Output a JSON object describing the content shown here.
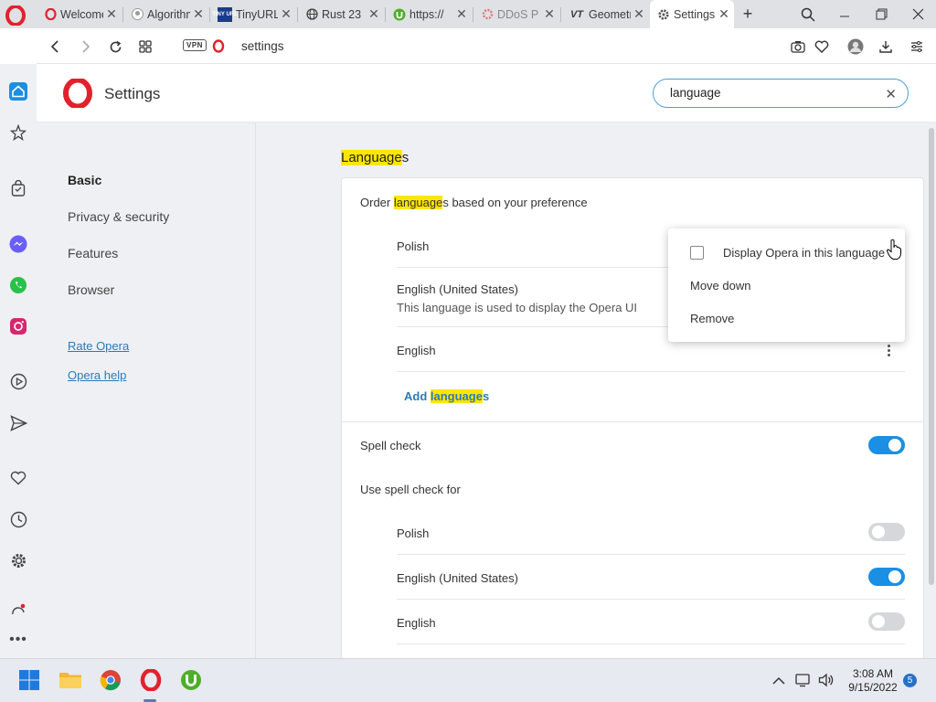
{
  "tabs": [
    {
      "title": "Welcome",
      "icon": "opera-icon"
    },
    {
      "title": "Algorithm",
      "icon": "github-icon"
    },
    {
      "title": "TinyURL",
      "icon": "tinyurl-icon"
    },
    {
      "title": "Rust 23",
      "icon": "globe-icon"
    },
    {
      "title": "https://",
      "icon": "utorrent-icon"
    },
    {
      "title": "DDoS P",
      "icon": "gear-pink-icon"
    },
    {
      "title": "Geometry",
      "icon": "vt-icon"
    },
    {
      "title": "Settings",
      "icon": "gear-icon"
    }
  ],
  "address": {
    "vpn_label": "VPN",
    "url": "settings"
  },
  "header": {
    "title": "Settings",
    "search_value": "language"
  },
  "nav": {
    "items": [
      "Basic",
      "Privacy & security",
      "Features",
      "Browser"
    ],
    "links": [
      "Rate Opera",
      "Opera help"
    ]
  },
  "main": {
    "section_title_hl": "Language",
    "section_title_rest": "s",
    "order_pre": "Order ",
    "order_hl": "language",
    "order_post": "s based on your preference",
    "languages": [
      {
        "name": "Polish",
        "note": ""
      },
      {
        "name": "English (United States)",
        "note": "This language is used to display the Opera UI"
      },
      {
        "name": "English",
        "note": ""
      }
    ],
    "add_pre": "Add ",
    "add_hl": "language",
    "add_post": "s",
    "spell_check_label": "Spell check",
    "spell_check_on": true,
    "use_spell_label": "Use spell check for",
    "spell_languages": [
      {
        "name": "Polish",
        "on": false
      },
      {
        "name": "English (United States)",
        "on": true
      },
      {
        "name": "English",
        "on": false
      }
    ]
  },
  "context_menu": {
    "items": [
      "Display Opera in this language",
      "Move down",
      "Remove"
    ]
  },
  "taskbar": {
    "time": "3:08 AM",
    "date": "9/15/2022",
    "notifications": "5"
  },
  "colors": {
    "opera_red": "#e3212d",
    "accent_blue": "#1a8fe3",
    "highlight": "#ffe600",
    "link": "#2b7bb9"
  }
}
